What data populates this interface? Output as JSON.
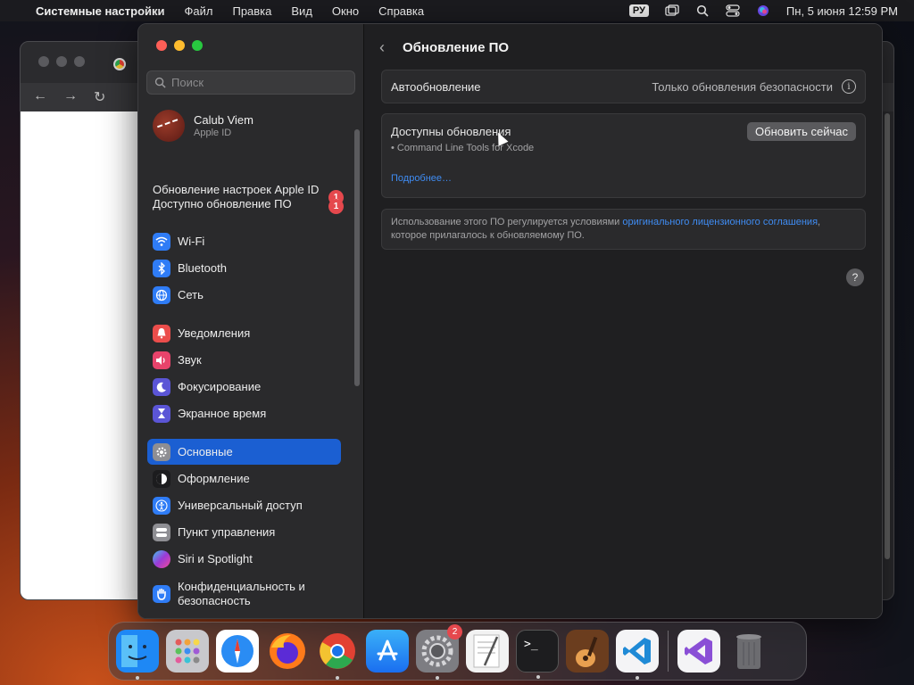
{
  "menubar": {
    "app_name": "Системные настройки",
    "menus": [
      "Файл",
      "Правка",
      "Вид",
      "Окно",
      "Справка"
    ],
    "lang": "РУ",
    "datetime": "Пн, 5 июня  12:59 PM"
  },
  "sidebar": {
    "search_placeholder": "Поиск",
    "account": {
      "name": "Calub Viem",
      "sub": "Apple ID"
    },
    "notices": [
      {
        "label": "Обновление настроек Apple ID",
        "badge": "1"
      },
      {
        "label": "Доступно обновление ПО",
        "badge": "1"
      }
    ],
    "items": [
      {
        "label": "Wi-Fi",
        "icon": "wifi-icon",
        "color": "#2f7cf6"
      },
      {
        "label": "Bluetooth",
        "icon": "bluetooth-icon",
        "color": "#2f7cf6"
      },
      {
        "label": "Сеть",
        "icon": "globe-icon",
        "color": "#2f7cf6"
      },
      {
        "label": "Уведомления",
        "icon": "bell-icon",
        "color": "#eb4d4b"
      },
      {
        "label": "Звук",
        "icon": "speaker-icon",
        "color": "#e8436b"
      },
      {
        "label": "Фокусирование",
        "icon": "moon-icon",
        "color": "#5b55d6"
      },
      {
        "label": "Экранное время",
        "icon": "hourglass-icon",
        "color": "#5b55d6"
      },
      {
        "label": "Основные",
        "icon": "gear-icon",
        "color": "#8e8e93",
        "active": true
      },
      {
        "label": "Оформление",
        "icon": "appearance-icon",
        "color": "#1c1c1e"
      },
      {
        "label": "Универсальный доступ",
        "icon": "accessibility-icon",
        "color": "#2f7cf6"
      },
      {
        "label": "Пункт управления",
        "icon": "control-center-icon",
        "color": "#8e8e93"
      },
      {
        "label": "Siri и Spotlight",
        "icon": "siri-icon",
        "color": "#9b3ad6"
      },
      {
        "label": "Конфиденциальность и безопасность",
        "icon": "hand-icon",
        "color": "#2f7cf6"
      }
    ]
  },
  "main": {
    "title": "Обновление ПО",
    "auto_update": {
      "label": "Автообновление",
      "value": "Только обновления безопасности"
    },
    "available": {
      "title": "Доступны обновления",
      "button": "Обновить сейчас",
      "item": "• Command Line Tools for Xcode",
      "more_link": "Подробнее…"
    },
    "license": {
      "text_before": "Использование этого ПО регулируется условиями ",
      "link": "оригинального лицензионного соглашения",
      "text_after": ",",
      "line2": "которое прилагалось к обновляемому ПО."
    },
    "help": "?"
  },
  "dock": {
    "apps": [
      {
        "name": "finder-icon",
        "color": "#1e88f5",
        "running": true
      },
      {
        "name": "launchpad-icon",
        "color": "#c8c8cc",
        "running": false
      },
      {
        "name": "safari-icon",
        "color": "#2a8cf4",
        "running": false
      },
      {
        "name": "firefox-icon",
        "color": "#ff7a1a",
        "running": false
      },
      {
        "name": "chrome-icon",
        "color": "#f2f2f2",
        "running": true
      },
      {
        "name": "app-store-icon",
        "color": "#1f8cf4",
        "running": false
      },
      {
        "name": "system-settings-icon",
        "color": "#7d7d82",
        "running": true,
        "badge": "2"
      },
      {
        "name": "textedit-icon",
        "color": "#f2f2f2",
        "running": false
      },
      {
        "name": "terminal-icon",
        "color": "#1d1d1f",
        "running": true
      },
      {
        "name": "garageband-icon",
        "color": "#6b3d1e",
        "running": false
      },
      {
        "name": "vscode-icon",
        "color": "#f4f4f6",
        "running": true
      },
      {
        "name": "visual-studio-icon",
        "color": "#f4f4f6",
        "running": false
      },
      {
        "name": "trash-icon",
        "color": "#6c6c70",
        "running": false
      }
    ]
  }
}
